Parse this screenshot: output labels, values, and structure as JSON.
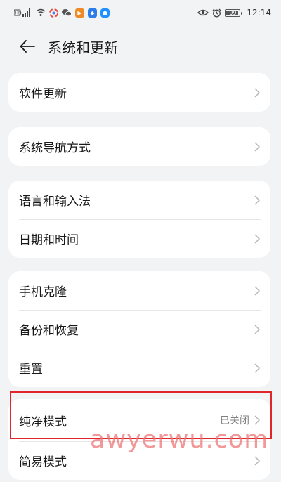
{
  "status_bar": {
    "time": "12:14",
    "battery_text": "99",
    "battery_level": 0.95
  },
  "header": {
    "title": "系统和更新"
  },
  "groups": [
    {
      "rows": [
        {
          "label": "软件更新"
        }
      ]
    },
    {
      "rows": [
        {
          "label": "系统导航方式"
        }
      ]
    },
    {
      "rows": [
        {
          "label": "语言和输入法"
        },
        {
          "label": "日期和时间"
        }
      ]
    },
    {
      "rows": [
        {
          "label": "手机克隆"
        },
        {
          "label": "备份和恢复"
        },
        {
          "label": "重置"
        }
      ]
    },
    {
      "rows": [
        {
          "label": "纯净模式",
          "value": "已关闭"
        },
        {
          "label": "简易模式"
        }
      ]
    }
  ],
  "watermark": "awyerwu.com",
  "colors": {
    "background": "#f1f3f5",
    "card": "#ffffff",
    "highlight_border": "#e0262b",
    "watermark": "#ec7676"
  }
}
